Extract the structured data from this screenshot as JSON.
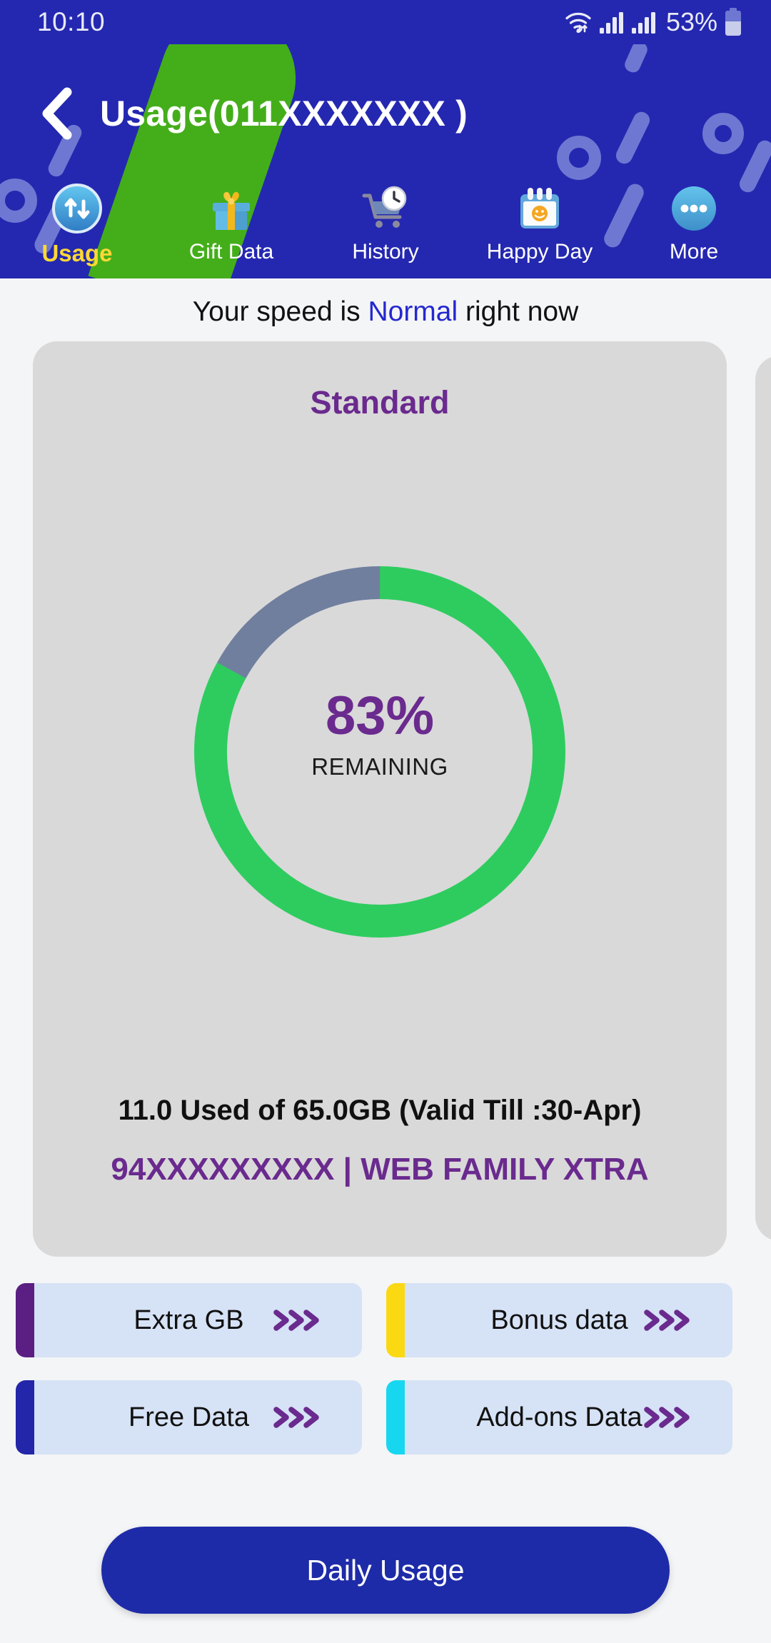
{
  "status_bar": {
    "time": "10:10",
    "battery_percent": "53%",
    "icons": [
      "wifi-icon",
      "signal-bars-icon",
      "signal-bars-icon",
      "battery-icon"
    ]
  },
  "header": {
    "title": "Usage(011XXXXXXX )",
    "back_icon": "back-chevron-icon",
    "background_color": "#2428B0",
    "accent_band_color": "#44AE1A"
  },
  "tabs": [
    {
      "label": "Usage",
      "icon": "data-transfer-icon",
      "active": true
    },
    {
      "label": "Gift Data",
      "icon": "gift-box-icon",
      "active": false
    },
    {
      "label": "History",
      "icon": "cart-clock-icon",
      "active": false
    },
    {
      "label": "Happy Day",
      "icon": "calendar-smiley-icon",
      "active": false
    },
    {
      "label": "More",
      "icon": "more-dots-icon",
      "active": false
    }
  ],
  "speed": {
    "prefix": "Your speed is ",
    "value": "Normal",
    "suffix": " right now",
    "value_color": "#2428D0"
  },
  "usage_card": {
    "title": "Standard",
    "percent_label": "83%",
    "percent_sub": "REMAINING",
    "used_text": "11.0 Used of 65.0GB (Valid Till :30-Apr)",
    "plan_text": "94XXXXXXXXX  |  WEB FAMILY XTRA",
    "remaining_color": "#2ECC5F",
    "used_color": "#717F9E",
    "card_color": "#D9D9D9"
  },
  "chart_data": {
    "type": "pie",
    "title": "Standard",
    "categories": [
      "Remaining",
      "Used"
    ],
    "values": [
      83,
      17
    ],
    "colors": [
      "#2ECC5F",
      "#717F9E"
    ],
    "center_label": "83%",
    "center_sublabel": "REMAINING",
    "units": "percent",
    "total_gb": 65.0,
    "used_gb": 11.0,
    "start_angle_deg": 0,
    "direction": "clockwise",
    "legend": "none",
    "grid": false
  },
  "tiles": [
    {
      "label": "Extra GB",
      "accent": "#5B1E83",
      "chevron": "triple-chevron-icon"
    },
    {
      "label": "Bonus data",
      "accent": "#FAD913",
      "chevron": "triple-chevron-icon"
    },
    {
      "label": "Free Data",
      "accent": "#2326A8",
      "chevron": "triple-chevron-icon"
    },
    {
      "label": "Add-ons Data",
      "accent": "#17D7F0",
      "chevron": "triple-chevron-icon"
    }
  ],
  "daily_button": {
    "label": "Daily Usage",
    "color": "#1E2BA8"
  }
}
